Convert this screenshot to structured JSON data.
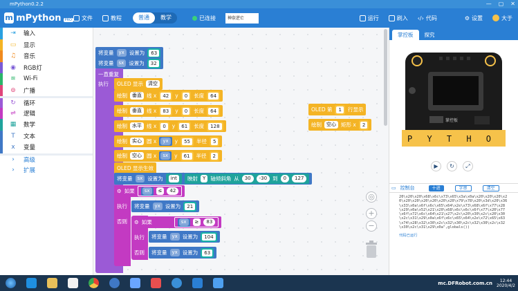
{
  "window": {
    "title": "mPython0.2.2",
    "min": "—",
    "max": "▢",
    "close": "✕"
  },
  "header": {
    "logo_name": "mPython",
    "logo_badge": "PRO",
    "file_label": "文件",
    "tutorial_label": "教程",
    "mode_normal": "普通",
    "mode_teach": "教学",
    "connection_status": "已连接",
    "device_select": "神奈逆亡",
    "run_label": "运行",
    "flash_label": "刷入",
    "code_label": "代码",
    "settings_label": "设置",
    "user_label": "大于"
  },
  "categories": [
    {
      "label": "输入",
      "color": "#2aa0e0",
      "icon": "input-icon"
    },
    {
      "label": "显示",
      "color": "#f4b425",
      "icon": "display-icon"
    },
    {
      "label": "音乐",
      "color": "#f08a1e",
      "icon": "music-icon"
    },
    {
      "label": "RGB灯",
      "color": "#7a5ad6",
      "icon": "rgb-icon"
    },
    {
      "label": "Wi-Fi",
      "color": "#2bb56a",
      "icon": "wifi-icon"
    },
    {
      "label": "广播",
      "color": "#e0457a",
      "icon": "broadcast-icon"
    },
    {
      "label": "循环",
      "color": "#9b5ad6",
      "icon": "loop-icon"
    },
    {
      "label": "逻辑",
      "color": "#c33ac2",
      "icon": "logic-icon"
    },
    {
      "label": "数学",
      "color": "#1fa39c",
      "icon": "math-icon"
    },
    {
      "label": "文本",
      "color": "#3f78c6",
      "icon": "text-icon"
    },
    {
      "label": "变量",
      "color": "#3f78c6",
      "icon": "variable-icon"
    },
    {
      "label": "高级",
      "color": "#2a7fd4",
      "icon": "chevron-right-icon"
    },
    {
      "label": "扩展",
      "color": "#2a7fd4",
      "icon": "chevron-right-icon"
    }
  ],
  "blocks": {
    "set_kw": "将变量",
    "set_to": "设置为",
    "var_yx": "yx",
    "var_sx": "sx",
    "val_63": "63",
    "val_32": "32",
    "repeat": "一直重复",
    "do": "执行",
    "oled_show": "OLED 显示",
    "clear": "清空",
    "draw": "绘制",
    "vertical": "垂直",
    "horizontal": "水平",
    "line": "线 x",
    "y": "y",
    "length": "长度",
    "solid": "实心",
    "hollow": "空心",
    "circle": "圆 x",
    "radius": "半径",
    "v1_x": "42",
    "v1_y": "0",
    "v1_len": "64",
    "v2_x": "83",
    "v2_y": "0",
    "v2_len": "64",
    "h_x": "0",
    "h_y": "61",
    "h_len": "128",
    "c1_x": "55",
    "c1_r": "5",
    "c2_y": "61",
    "c2_r": "2",
    "oled_take": "OLED 显示生效",
    "int": "int",
    "map": "映射",
    "Y": "Y",
    "tilt": "轴倾斜角",
    "from": "从",
    "m1": "30",
    "m2": "-30",
    "to": "到",
    "m3": "0",
    "m4": "127",
    "if": "如果",
    "else": "否则",
    "le": "≤",
    "ge": "≥",
    "n42": "42",
    "n21": "21",
    "n83": "83",
    "n104": "104",
    "n63": "63",
    "oled_line": "OLED 第",
    "line_no": "1",
    "line_show": "行显示",
    "rect": "矩形 x",
    "rect_x": "2"
  },
  "right_panel": {
    "tab_control": "掌控板",
    "tab_explore": "探究",
    "board_logo": "掌控板",
    "board_pins": "P Y T H O N",
    "console_title": "控制台",
    "btn_hex": "十进",
    "btn_text": "字串",
    "btn_clear": "清空",
    "console_text": "20\\x20\\x20\\x68\\x6c\\x73\\x65\\x3a\\x0a\\x20\\x20\\x20\\x20\\x20\\x20\\x20\\x20\\x20\\x20\\x79\\x78\\x20\\x3d\\x20\\x36\\x33\\x0a\\x6f\\x6c\\x65\\x64\\x2e\\x73\\x68\\x6f\\x77\\x28\\x29\\x0a\\x52\\x21\\x20\\x68\\x6c\\x6c\\x6f\\x77\\x20\\x77\\x6f\\x72\\x6c\\x64\\x21\\x27\\x2c\\x20\\x30\\x2c\\x20\\x30\\x2c\\x31\\x29\\x0a\\x6f\\x6c\\x65\\x64\\x2e\\x72\\x65\\x63\\x74\\x28\\x32\\x30\\x2c\\x32\\x30\\x2c\\x32\\x30\\x2c\\x32\\x30\\x2c\\x31\\x29\\x0a\",globals())",
    "console_status": "代码已运行"
  },
  "taskbar": {
    "time": "12:44",
    "date": "2020/4/2",
    "watermark": "mc.DFRobot.com.cn"
  }
}
